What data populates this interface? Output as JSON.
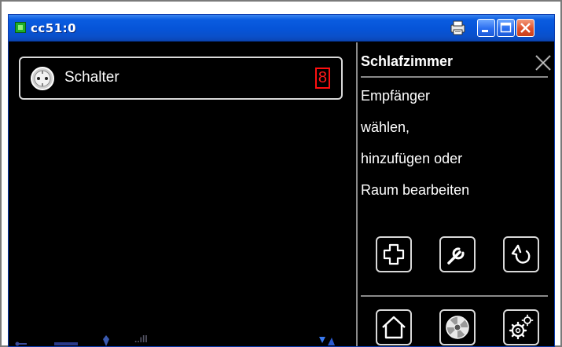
{
  "window": {
    "title": "cc51:0",
    "icons": {
      "app": "app-icon",
      "print": "printer-icon",
      "minimize": "minimize-icon",
      "maximize": "maximize-icon",
      "close": "close-icon"
    }
  },
  "main": {
    "items": [
      {
        "label": "Schalter",
        "icon": "power-socket-icon",
        "badge": "8"
      }
    ]
  },
  "side_panel": {
    "room_name": "Schlafzimmer",
    "instruction": [
      "Empfänger",
      "wählen,",
      "hinzufügen oder",
      "Raum bearbeiten"
    ],
    "actions": [
      {
        "name": "add-receiver-button",
        "icon": "plus-icon"
      },
      {
        "name": "edit-button",
        "icon": "wrench-icon"
      },
      {
        "name": "back-button",
        "icon": "back-arrow-icon"
      }
    ],
    "nav": [
      {
        "name": "home-button",
        "icon": "house-icon"
      },
      {
        "name": "scenes-button",
        "icon": "fan-icon"
      },
      {
        "name": "settings-button",
        "icon": "gears-icon"
      }
    ]
  },
  "statusbar": {
    "icons": [
      "usb-icon",
      "network-icon",
      "antenna-icon",
      "signal-bars-icon",
      "battery-icon"
    ],
    "signal": "..ıll"
  },
  "colors": {
    "titlebar": "#0654d8",
    "badge": "#ff1a1a",
    "background": "#000000",
    "border": "#d9d9d9"
  }
}
